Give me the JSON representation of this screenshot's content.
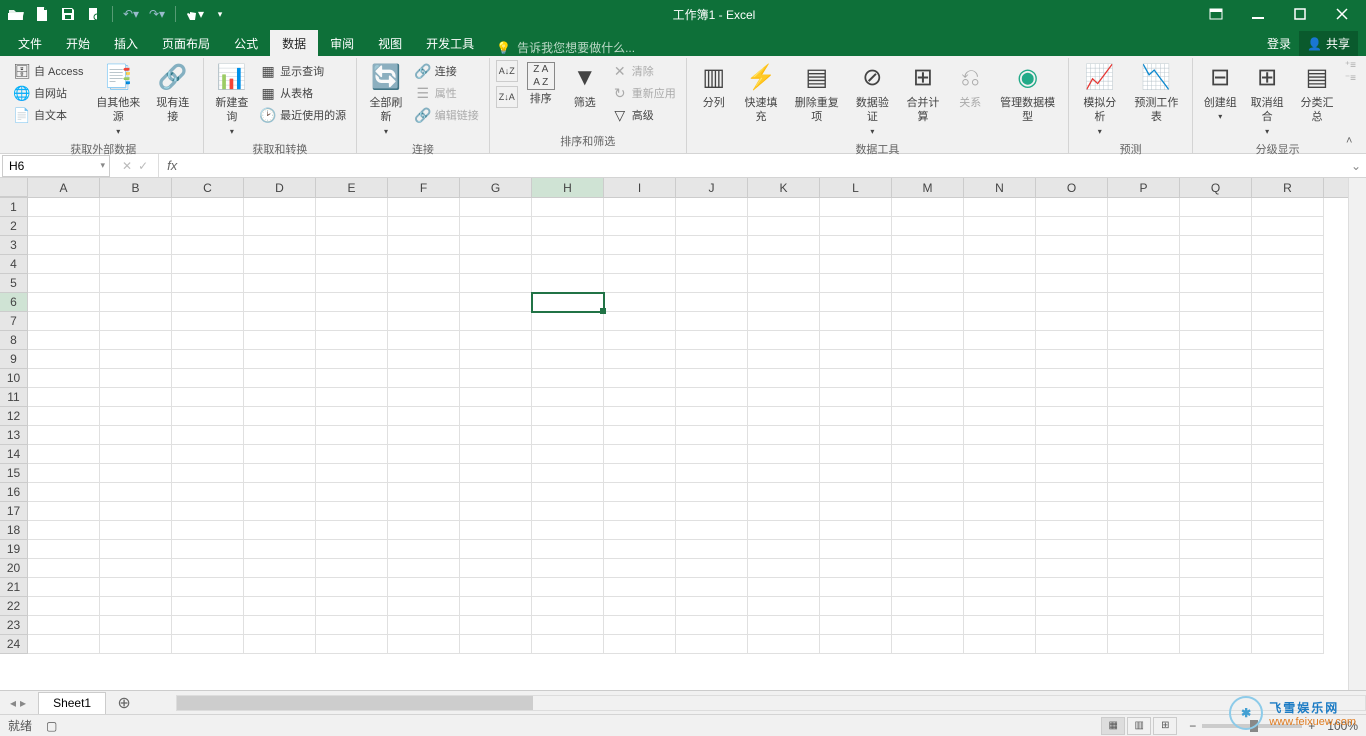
{
  "title": "工作簿1 - Excel",
  "qat": {
    "open": "打开",
    "new": "新建",
    "save": "保存",
    "preview": "打印预览",
    "undo": "撤销",
    "redo": "恢复",
    "touch": "触摸"
  },
  "tabs": {
    "file": "文件",
    "home": "开始",
    "insert": "插入",
    "layout": "页面布局",
    "formulas": "公式",
    "data": "数据",
    "review": "审阅",
    "view": "视图",
    "developer": "开发工具"
  },
  "tellme": "告诉我您想要做什么...",
  "login": "登录",
  "share": "共享",
  "ribbon": {
    "ext": {
      "access": "自 Access",
      "web": "自网站",
      "text": "自文本",
      "other": "自其他来源",
      "existing": "现有连接",
      "label": "获取外部数据"
    },
    "getTransform": {
      "newQuery": "新建查询",
      "showQuery": "显示查询",
      "fromTable": "从表格",
      "recent": "最近使用的源",
      "label": "获取和转换"
    },
    "conn": {
      "refresh": "全部刷新",
      "connections": "连接",
      "properties": "属性",
      "editLinks": "编辑链接",
      "label": "连接"
    },
    "sort": {
      "sort": "排序",
      "filter": "筛选",
      "clear": "清除",
      "reapply": "重新应用",
      "advanced": "高级",
      "label": "排序和筛选"
    },
    "tools": {
      "textToCol": "分列",
      "flash": "快速填充",
      "removeDup": "删除重复项",
      "validation": "数据验证",
      "consolidate": "合并计算",
      "relations": "关系",
      "model": "管理数据模型",
      "label": "数据工具"
    },
    "forecast": {
      "whatIf": "模拟分析",
      "sheet": "预测工作表",
      "label": "预测"
    },
    "outline": {
      "group": "创建组",
      "ungroup": "取消组合",
      "subtotal": "分类汇总",
      "label": "分级显示"
    }
  },
  "nameBox": "H6",
  "columns": [
    "A",
    "B",
    "C",
    "D",
    "E",
    "F",
    "G",
    "H",
    "I",
    "J",
    "K",
    "L",
    "M",
    "N",
    "O",
    "P",
    "Q",
    "R"
  ],
  "rowCount": 24,
  "activeCell": {
    "row": 6,
    "col": "H"
  },
  "sheetTab": "Sheet1",
  "status": "就绪",
  "zoom": "100%",
  "watermark": {
    "brand": "飞雪娱乐网",
    "url": "www.feixuew.com"
  }
}
